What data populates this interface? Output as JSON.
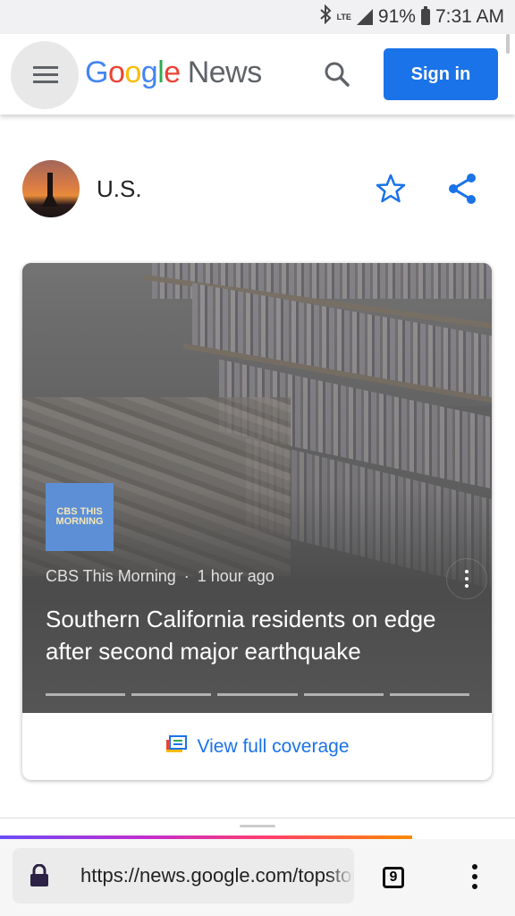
{
  "status_bar": {
    "network": "LTE",
    "battery": "91%",
    "time": "7:31 AM",
    "icons": [
      "bluetooth-icon",
      "signal-icon",
      "battery-icon"
    ]
  },
  "header": {
    "logo_google": "Google",
    "logo_news": "News",
    "sign_in_label": "Sign in",
    "accent_color": "#1a73e8"
  },
  "topic": {
    "title": "U.S."
  },
  "story": {
    "source_logo_text": "CBS THIS MORNING",
    "source": "CBS This Morning",
    "separator": "·",
    "time": "1 hour ago",
    "headline": "Southern California residents on edge after second major earthquake",
    "carousel_pages": 5,
    "coverage_label": "View full coverage"
  },
  "browser": {
    "url": "https://news.google.com/topstories",
    "tab_count": "9",
    "load_progress": 0.8
  }
}
